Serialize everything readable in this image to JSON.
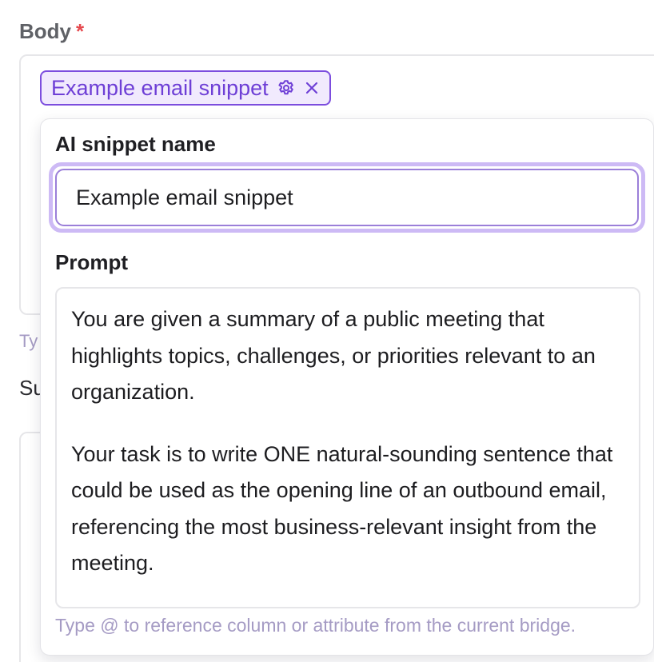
{
  "field": {
    "label": "Body",
    "required_marker": "*"
  },
  "chip": {
    "label": "Example email snippet",
    "settings_icon": "gear-icon",
    "remove_icon": "close-icon"
  },
  "background": {
    "hint_fragment": "Ty",
    "next_label_fragment": "Su"
  },
  "popover": {
    "name_label": "AI snippet name",
    "name_value": "Example email snippet",
    "prompt_label": "Prompt",
    "prompt_paragraphs": [
      "You are given a summary of a public meeting that highlights topics, challenges, or priorities relevant to an organization.",
      "Your task is to write ONE natural-sounding sentence that could be used as the opening line of an outbound email, referencing the most business-relevant insight from the meeting."
    ],
    "hint": "Type @ to reference column or attribute from the current bridge."
  },
  "colors": {
    "accent": "#7c4dde",
    "accent_bg": "#f1eafd",
    "focus_ring": "#cdbaf5",
    "required": "#e5484d",
    "hint": "#a59bc4"
  }
}
